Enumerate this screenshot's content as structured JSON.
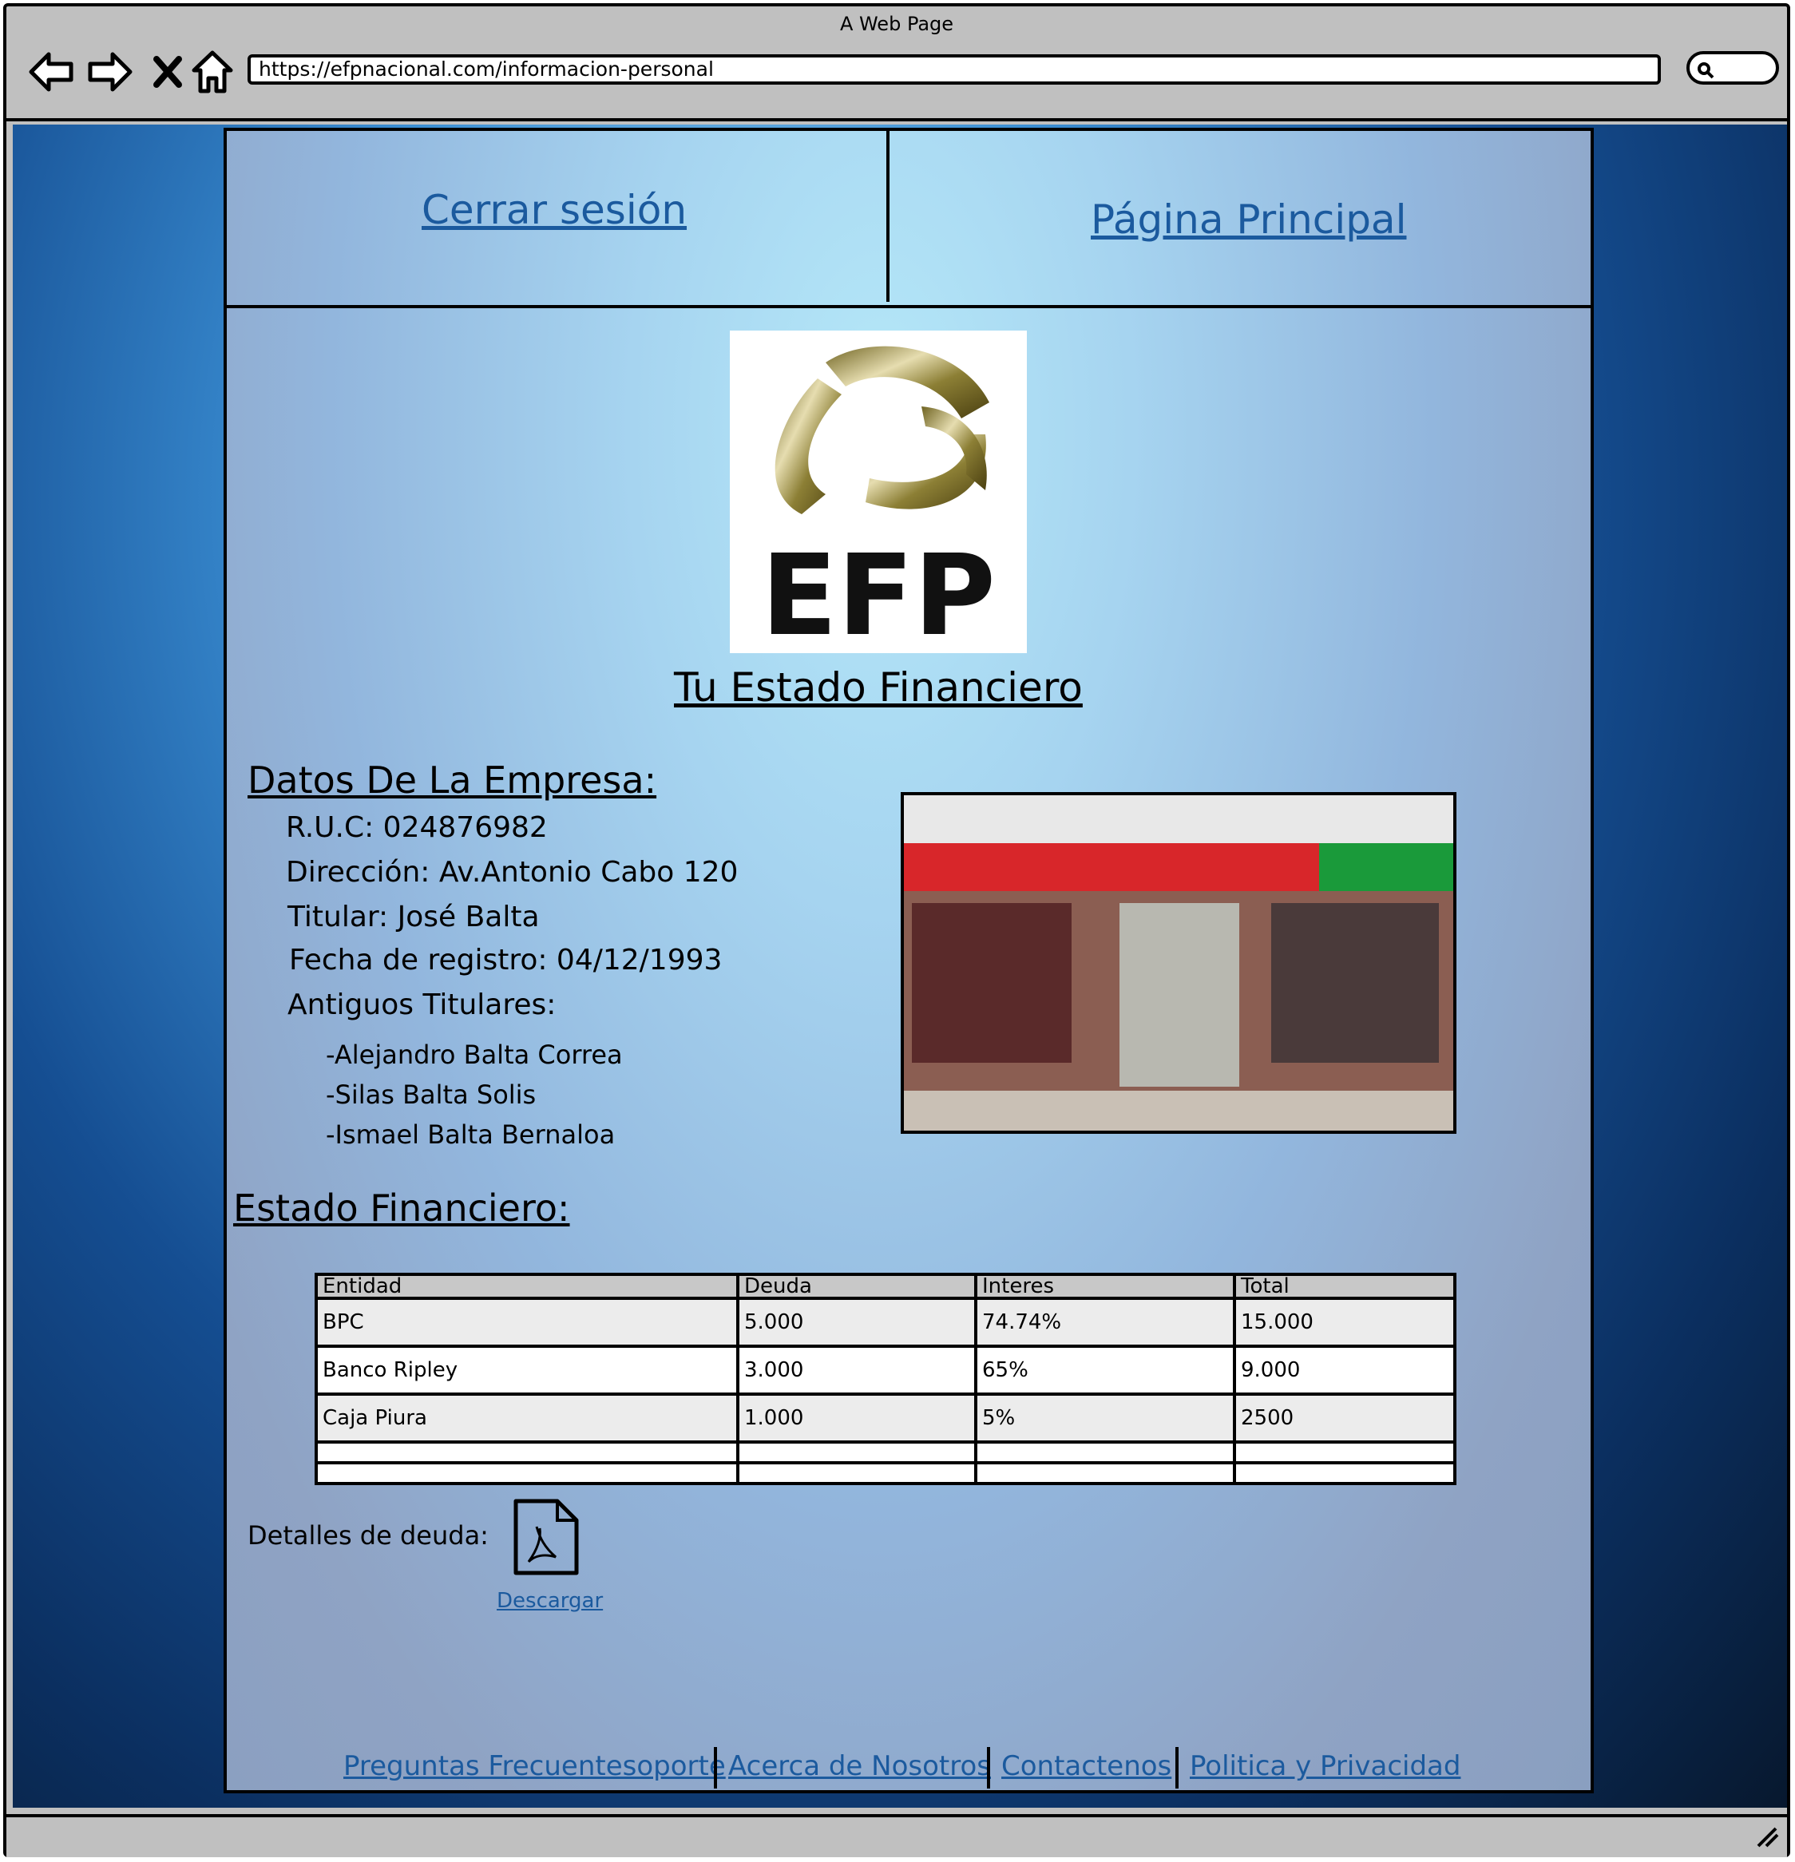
{
  "browser": {
    "title": "A Web Page",
    "url": "https://efpnacional.com/informacion-personal"
  },
  "nav": {
    "logout": "Cerrar sesión",
    "home": "Página Principal"
  },
  "logo": {
    "text": "EFP"
  },
  "page_heading": "Tu Estado Financiero",
  "company": {
    "title": "Datos De La Empresa:",
    "ruc": "R.U.C: 024876982",
    "address": "Dirección: Av.Antonio Cabo 120",
    "owner": "Titular: José Balta",
    "registered": "Fecha de registro: 04/12/1993",
    "former_title": "Antiguos Titulares:",
    "former": [
      "-Alejandro Balta Correa",
      "-Silas Balta Solis",
      "-Ismael Balta Bernaloa"
    ]
  },
  "financial": {
    "title": "Estado Financiero:",
    "columns": [
      "Entidad",
      "Deuda",
      "Interes",
      "Total"
    ],
    "rows": [
      [
        "BPC",
        "5.000",
        "74.74%",
        "15.000"
      ],
      [
        "Banco Ripley",
        "3.000",
        "65%",
        "9.000"
      ],
      [
        "Caja Piura",
        "1.000",
        "5%",
        "2500"
      ]
    ]
  },
  "download": {
    "label": "Detalles de deuda:",
    "link": "Descargar"
  },
  "footer": {
    "links": [
      "Preguntas Frecuentesoporte",
      "Acerca de Nosotros",
      "Contactenos",
      "Politica y Privacidad"
    ]
  },
  "icons": {
    "back": "back-arrow-icon",
    "forward": "forward-arrow-icon",
    "stop": "close-icon",
    "home": "home-icon",
    "search": "search-icon",
    "pdf": "pdf-file-icon",
    "resize": "resize-grip-icon"
  },
  "colors": {
    "link": "#1b5a9e",
    "page_bg": "#154e92"
  }
}
